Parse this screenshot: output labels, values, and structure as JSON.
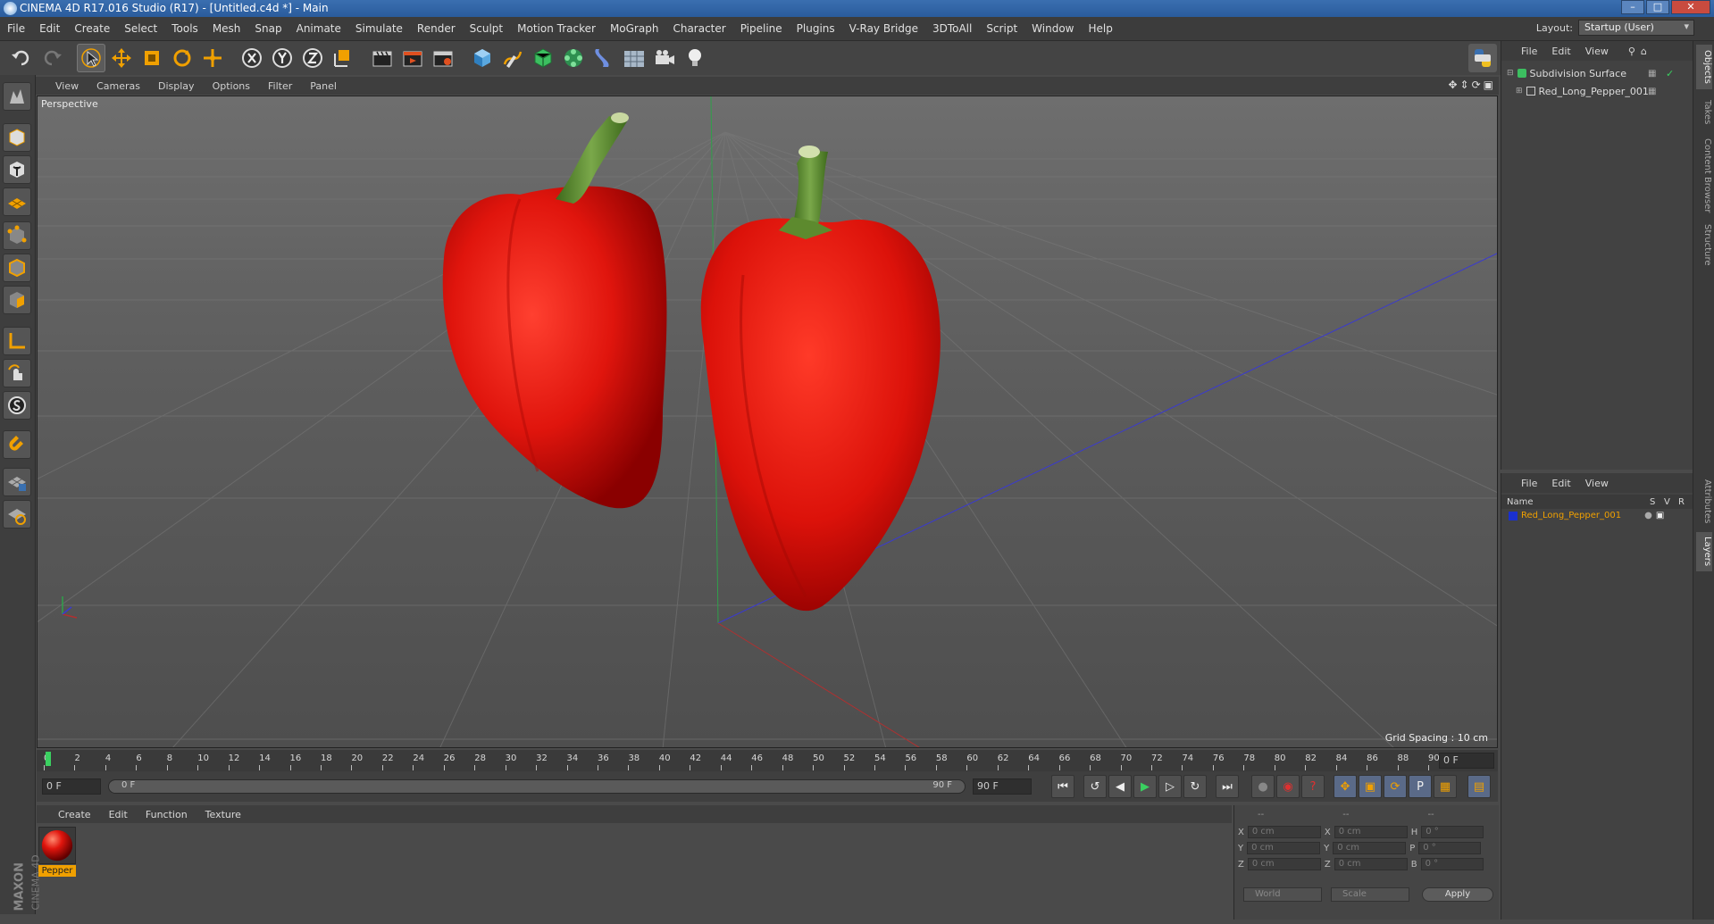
{
  "window": {
    "title": "CINEMA 4D R17.016 Studio (R17) - [Untitled.c4d *] - Main",
    "minimize": "–",
    "maximize": "□",
    "close": "✕"
  },
  "menubar": {
    "items": [
      "File",
      "Edit",
      "Create",
      "Select",
      "Tools",
      "Mesh",
      "Snap",
      "Animate",
      "Simulate",
      "Render",
      "Sculpt",
      "Motion Tracker",
      "MoGraph",
      "Character",
      "Pipeline",
      "Plugins",
      "V-Ray Bridge",
      "3DToAll",
      "Script",
      "Window",
      "Help"
    ],
    "layout_label": "Layout:",
    "layout_value": "Startup (User)"
  },
  "toolbar": {
    "icons": [
      "undo-icon",
      "redo-icon",
      "select-arrow-icon",
      "move-icon",
      "scale-icon",
      "rotate-icon",
      "transform-icon",
      "x-axis-icon",
      "y-axis-icon",
      "z-axis-icon",
      "coordinate-system-icon",
      "render-view-icon",
      "render-active-icon",
      "render-settings-icon",
      "cube-icon",
      "pen-spline-icon",
      "subdivision-icon",
      "array-icon",
      "deformer-icon",
      "floor-icon",
      "camera-icon",
      "light-icon"
    ],
    "python_icon": "python-icon"
  },
  "left_tools": {
    "icons": [
      "make-editable-icon",
      "model-mode-icon",
      "texture-mode-icon",
      "workplane-icon",
      "points-mode-icon",
      "edges-mode-icon",
      "polygons-mode-icon",
      "axis-mode-icon",
      "tweak-icon",
      "solo-icon",
      "magnet-icon",
      "grid-snap-icon",
      "locked-workplane-icon"
    ]
  },
  "viewport": {
    "menu": [
      "View",
      "Cameras",
      "Display",
      "Options",
      "Filter",
      "Panel"
    ],
    "label": "Perspective",
    "grid_spacing": "Grid Spacing : 10 cm",
    "nav_icons": [
      "move-view-icon",
      "zoom-view-icon",
      "rotate-view-icon",
      "maximize-view-icon"
    ]
  },
  "timeline": {
    "ticks": [
      "0",
      "2",
      "4",
      "6",
      "8",
      "10",
      "12",
      "14",
      "16",
      "18",
      "20",
      "22",
      "24",
      "26",
      "28",
      "30",
      "32",
      "34",
      "36",
      "38",
      "40",
      "42",
      "44",
      "46",
      "48",
      "50",
      "52",
      "54",
      "56",
      "58",
      "60",
      "62",
      "64",
      "66",
      "68",
      "70",
      "72",
      "74",
      "76",
      "78",
      "80",
      "82",
      "84",
      "86",
      "88",
      "90"
    ],
    "current_frame_display": "0 F",
    "start_field": "0 F",
    "range_start": "0 F",
    "range_end": "90 F",
    "end_field": "90 F"
  },
  "material_manager": {
    "menu": [
      "Create",
      "Edit",
      "Function",
      "Texture"
    ],
    "material_name": "Pepper"
  },
  "branding": {
    "maxon": "MAXON",
    "cinema": "CINEMA 4D"
  },
  "coordinates": {
    "header": [
      "--",
      "--",
      "--"
    ],
    "rows": [
      {
        "a": "X",
        "av": "0 cm",
        "b": "X",
        "bv": "0 cm",
        "c": "H",
        "cv": "0 °"
      },
      {
        "a": "Y",
        "av": "0 cm",
        "b": "Y",
        "bv": "0 cm",
        "c": "P",
        "cv": "0 °"
      },
      {
        "a": "Z",
        "av": "0 cm",
        "b": "Z",
        "bv": "0 cm",
        "c": "B",
        "cv": "0 °"
      }
    ],
    "space": "World",
    "mode": "Scale",
    "apply": "Apply"
  },
  "object_manager": {
    "menu": [
      "File",
      "Edit",
      "View"
    ],
    "objects": [
      "Subdivision Surface",
      "Red_Long_Pepper_001"
    ]
  },
  "layer_manager": {
    "menu": [
      "File",
      "Edit",
      "View"
    ],
    "columns": [
      "Name",
      "S",
      "V",
      "R"
    ],
    "layer": "Red_Long_Pepper_001"
  },
  "side_tabs": [
    "Objects",
    "Takes",
    "Content Browser",
    "Structure",
    "Attributes",
    "Layers"
  ],
  "colors": {
    "accent": "#f0a000",
    "pepper": "#e0150d",
    "stem": "#5d8a2e"
  }
}
